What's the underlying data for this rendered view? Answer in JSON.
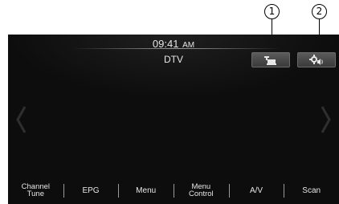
{
  "callouts": [
    "1",
    "2"
  ],
  "header": {
    "time": "09:41",
    "ampm": "AM",
    "source": "DTV"
  },
  "top_buttons": [
    {
      "icon": "audio-setup-icon"
    },
    {
      "icon": "sound-settings-icon"
    }
  ],
  "nav": {
    "prev_icon": "chevron-left-icon",
    "next_icon": "chevron-right-icon"
  },
  "bottom_bar": [
    {
      "line1": "Channel",
      "line2": "Tune"
    },
    {
      "line1": "EPG"
    },
    {
      "line1": "Menu"
    },
    {
      "line1": "Menu",
      "line2": "Control"
    },
    {
      "line1": "A/V"
    },
    {
      "line1": "Scan"
    }
  ]
}
